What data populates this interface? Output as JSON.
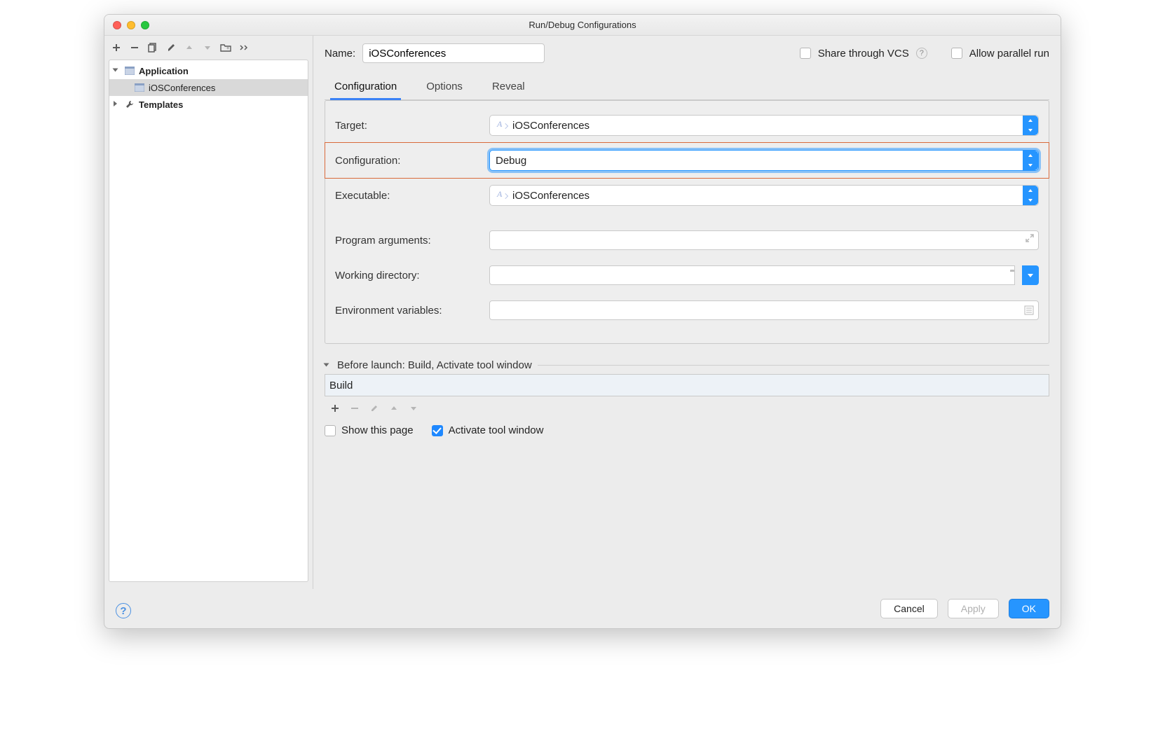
{
  "window": {
    "title": "Run/Debug Configurations"
  },
  "sidebar": {
    "items": [
      {
        "label": "Application",
        "expanded": true,
        "bold": true
      },
      {
        "label": "iOSConferences",
        "selected": true,
        "indent": 28
      },
      {
        "label": "Templates",
        "expanded": false,
        "bold": true
      }
    ]
  },
  "header": {
    "name_label": "Name:",
    "name_value": "iOSConferences",
    "share_label": "Share through VCS",
    "allow_label": "Allow parallel run"
  },
  "tabs": [
    {
      "label": "Configuration",
      "active": true
    },
    {
      "label": "Options"
    },
    {
      "label": "Reveal"
    }
  ],
  "form": {
    "target_label": "Target:",
    "target_value": "iOSConferences",
    "config_label": "Configuration:",
    "config_value": "Debug",
    "exec_label": "Executable:",
    "exec_value": "iOSConferences",
    "args_label": "Program arguments:",
    "wdir_label": "Working directory:",
    "env_label": "Environment variables:"
  },
  "before": {
    "title": "Before launch: Build, Activate tool window",
    "item": "Build",
    "show_label": "Show this page",
    "activate_label": "Activate tool window"
  },
  "buttons": {
    "cancel": "Cancel",
    "apply": "Apply",
    "ok": "OK"
  }
}
